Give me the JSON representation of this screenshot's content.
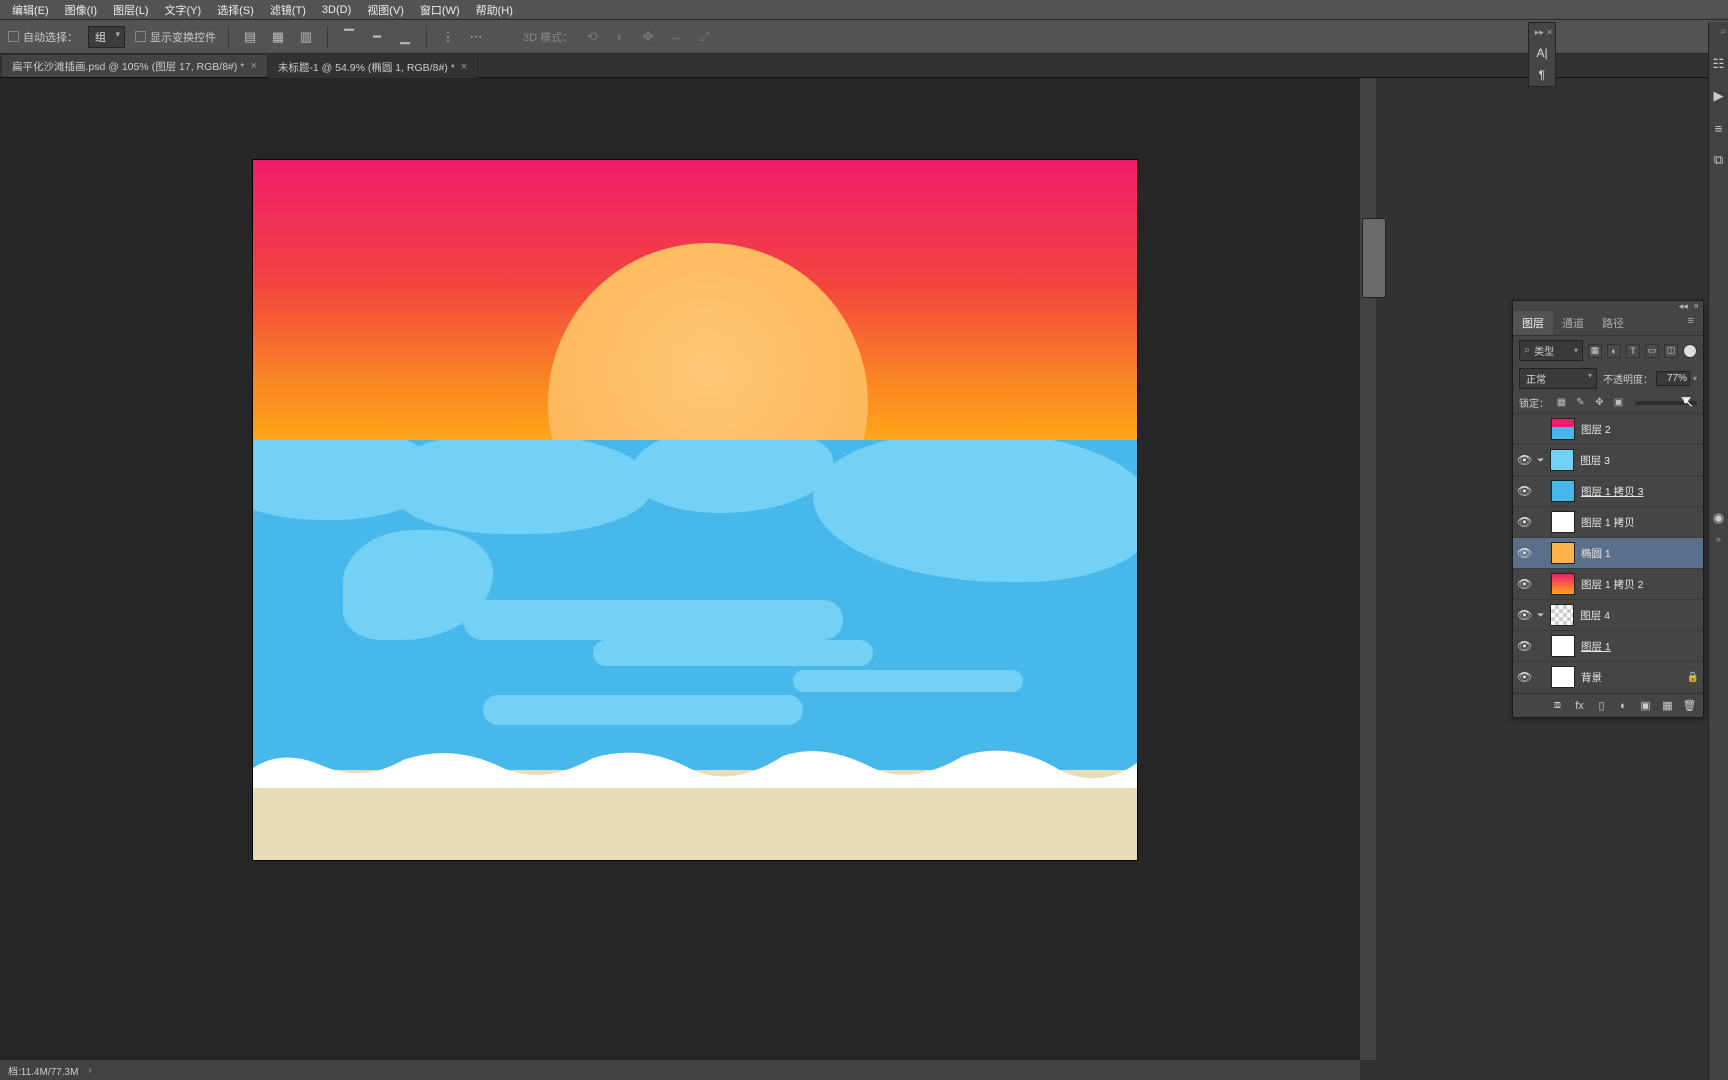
{
  "menu": {
    "items": [
      "编辑(E)",
      "图像(I)",
      "图层(L)",
      "文字(Y)",
      "选择(S)",
      "滤镜(T)",
      "3D(D)",
      "视图(V)",
      "窗口(W)",
      "帮助(H)"
    ]
  },
  "options": {
    "auto_select": "自动选择：",
    "group": "组",
    "show_transform": "显示变换控件",
    "mode3d": "3D 模式："
  },
  "tabs": [
    {
      "label": "扁平化沙滩插画.psd @ 105% (图层 17, RGB/8#) *",
      "active": false
    },
    {
      "label": "未标题-1 @ 54.9% (椭圆 1, RGB/8#) *",
      "active": true
    }
  ],
  "status": {
    "doc": "档:11.4M/77.3M"
  },
  "panel": {
    "tabs": {
      "layers": "图层",
      "channels": "通道",
      "paths": "路径"
    },
    "filter": "类型",
    "blend": "正常",
    "opacity_label": "不透明度：",
    "opacity": "77%",
    "lock_label": "锁定：",
    "layers": [
      {
        "name": "图层 2",
        "vis": false,
        "th": "th-mini"
      },
      {
        "name": "图层 3",
        "vis": true,
        "th": "th-sea2",
        "link": true
      },
      {
        "name": "图层 1 拷贝 3",
        "vis": true,
        "th": "th-sea",
        "ul": true
      },
      {
        "name": "图层 1 拷贝",
        "vis": true,
        "th": "th-white"
      },
      {
        "name": "椭圆 1",
        "vis": true,
        "th": "th-sun",
        "sel": true,
        "shape": true
      },
      {
        "name": "图层 1 拷贝 2",
        "vis": true,
        "th": "th-grad"
      },
      {
        "name": "图层 4",
        "vis": true,
        "th": "th-check",
        "link": true
      },
      {
        "name": "图层 1",
        "vis": true,
        "th": "th-white",
        "ul": true
      },
      {
        "name": "背景",
        "vis": true,
        "th": "th-white",
        "locked": true
      }
    ]
  }
}
